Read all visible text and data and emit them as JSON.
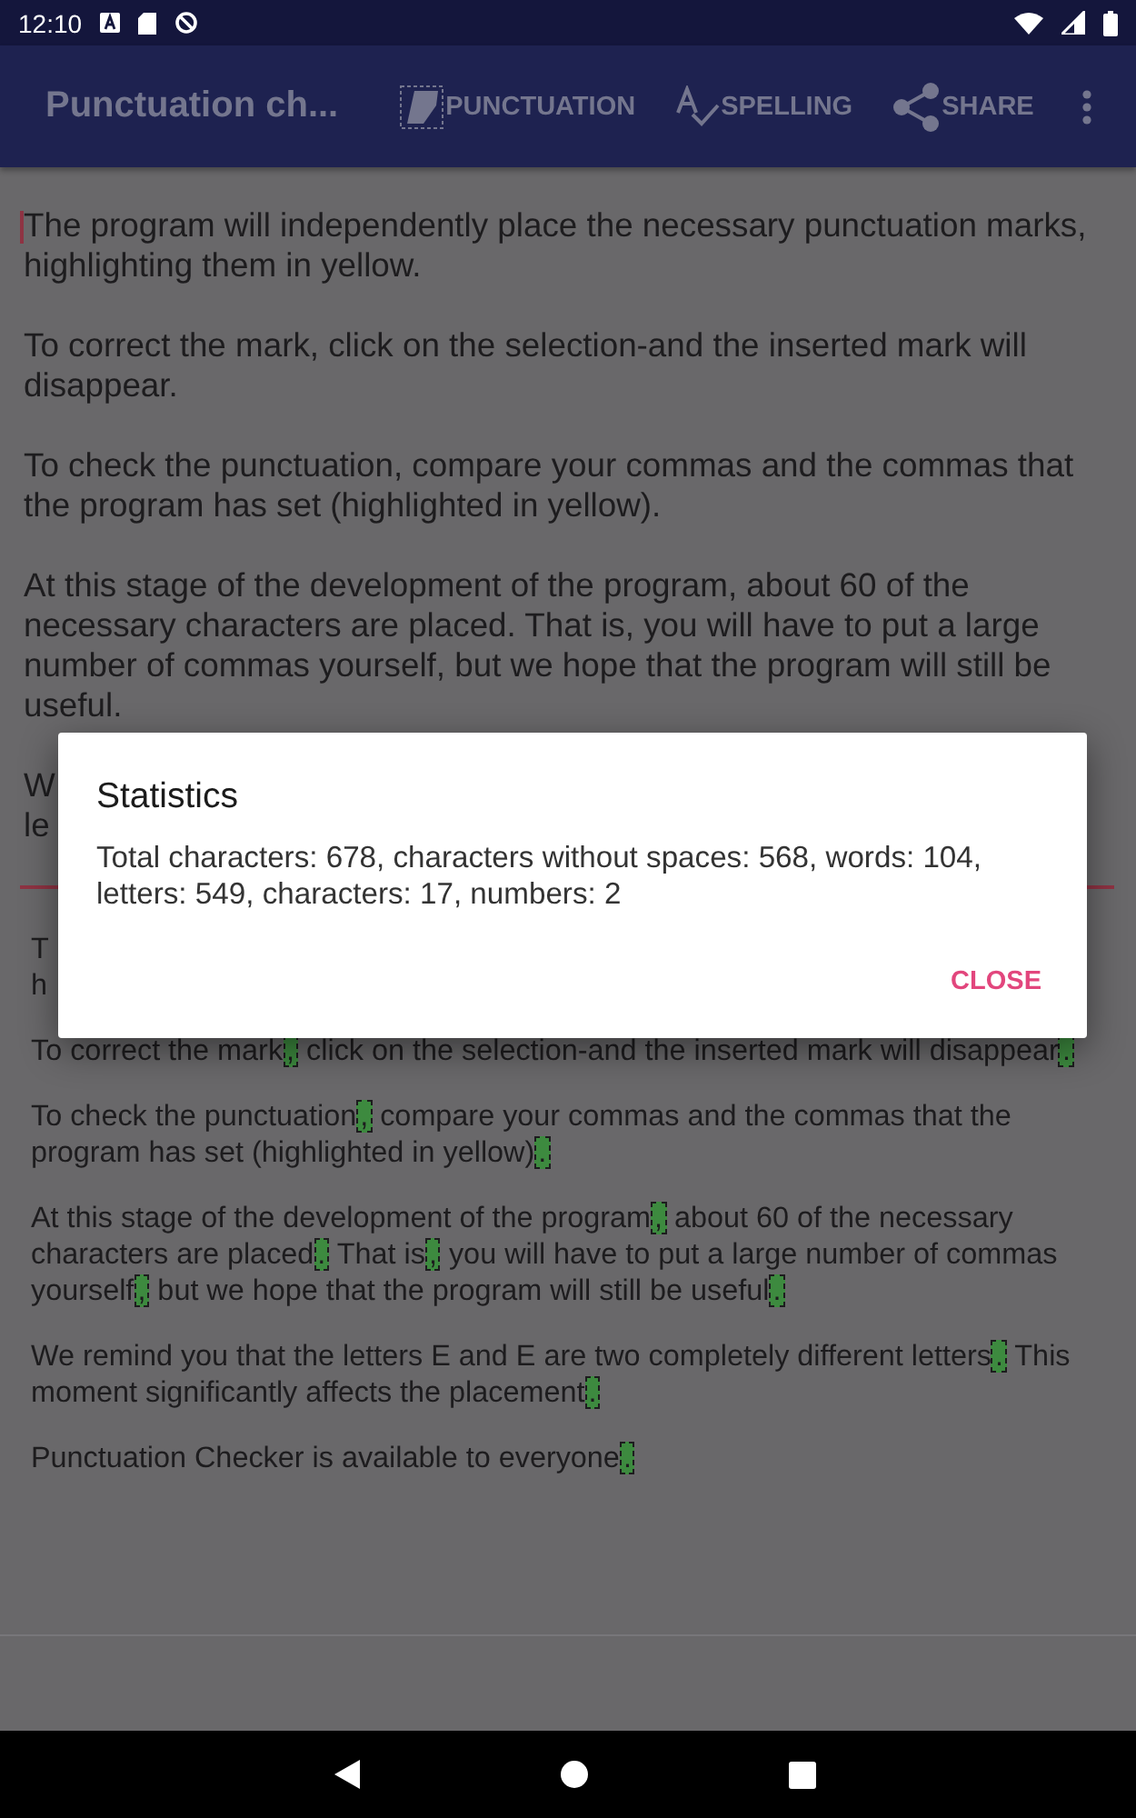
{
  "status_bar": {
    "time": "12:10"
  },
  "toolbar": {
    "title": "Punctuation ch...",
    "actions": [
      "PUNCTUATION",
      "SPELLING",
      "SHARE"
    ]
  },
  "editor": {
    "paragraphs": [
      "The program will independently place the necessary punctuation marks, highlighting them in yellow.",
      "To correct the mark, click on the selection-and the inserted mark will disappear.",
      "To check the punctuation, compare your commas and the commas that the program has set (highlighted in yellow).",
      "At this stage of the development of the program, about 60 of the necessary characters are placed. That is, you will have to put a large number of commas yourself, but we hope that the program will still be useful.",
      "W\nle"
    ]
  },
  "output": {
    "paragraphs": [
      [
        {
          "kind": "text",
          "text": "T\nh"
        }
      ],
      [
        {
          "kind": "text",
          "text": "To correct the mark"
        },
        {
          "kind": "mark",
          "text": ","
        },
        {
          "kind": "text",
          "text": " click on the selection-and the inserted mark will disappear"
        },
        {
          "kind": "mark",
          "text": "."
        }
      ],
      [
        {
          "kind": "text",
          "text": "To check the punctuation"
        },
        {
          "kind": "mark",
          "text": ","
        },
        {
          "kind": "text",
          "text": " compare your commas and the commas that the program has set (highlighted in yellow)"
        },
        {
          "kind": "mark",
          "text": "."
        }
      ],
      [
        {
          "kind": "text",
          "text": "At this stage of the development of the program"
        },
        {
          "kind": "mark",
          "text": ","
        },
        {
          "kind": "text",
          "text": " about 60 of the necessary characters are placed"
        },
        {
          "kind": "mark",
          "text": "."
        },
        {
          "kind": "text",
          "text": " That is"
        },
        {
          "kind": "mark",
          "text": ","
        },
        {
          "kind": "text",
          "text": " you will have to put a large number of commas yourself"
        },
        {
          "kind": "mark",
          "text": ","
        },
        {
          "kind": "text",
          "text": " but we hope that the program will still be useful"
        },
        {
          "kind": "mark",
          "text": "."
        }
      ],
      [
        {
          "kind": "text",
          "text": "We remind you that the letters E and E are two completely different letters"
        },
        {
          "kind": "mark",
          "text": "."
        },
        {
          "kind": "text",
          "text": " This moment significantly affects the placement"
        },
        {
          "kind": "mark",
          "text": "."
        }
      ],
      [
        {
          "kind": "text",
          "text": "Punctuation Checker is available to everyone"
        },
        {
          "kind": "mark",
          "text": "."
        }
      ]
    ]
  },
  "dialog": {
    "title": "Statistics",
    "message": "Total characters: 678, characters without spaces: 568, words: 104, letters: 549, characters: 17, numbers: 2",
    "button": "CLOSE"
  }
}
